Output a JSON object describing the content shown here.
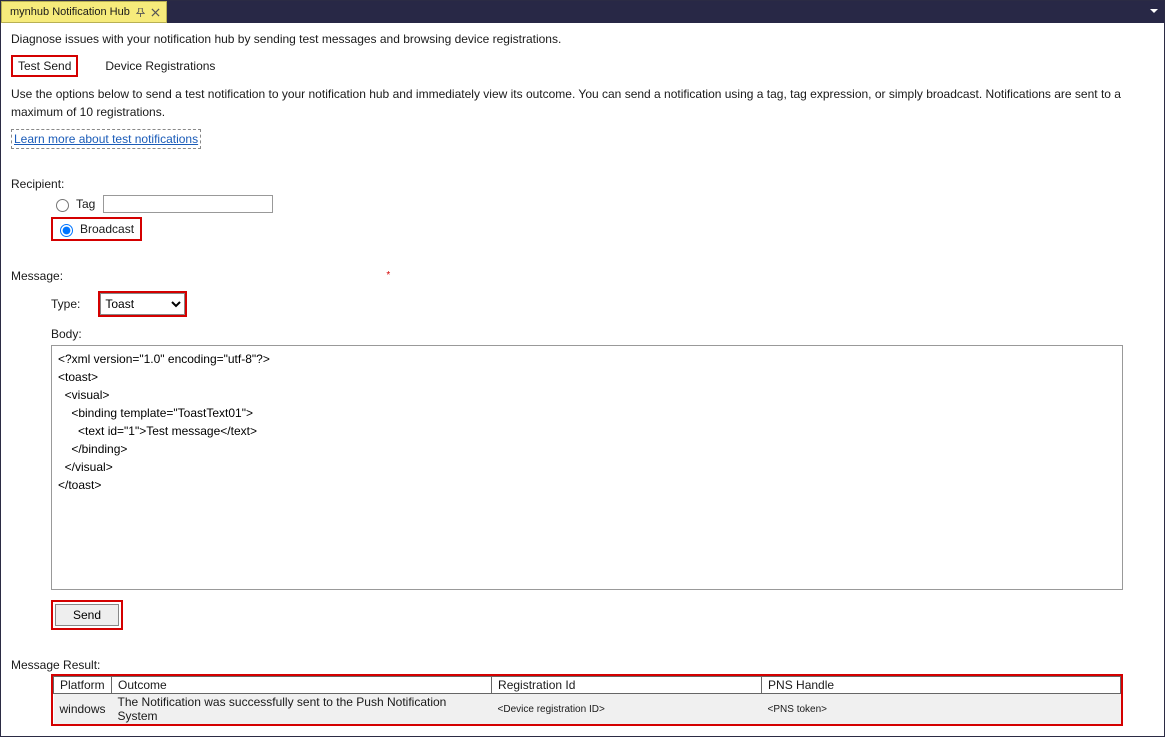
{
  "window": {
    "tab_title": "mynhub Notification Hub"
  },
  "header": {
    "description": "Diagnose issues with your notification hub by sending test messages and browsing device registrations."
  },
  "subtabs": {
    "test_send": "Test Send",
    "device_registrations": "Device Registrations"
  },
  "instructions": {
    "text": "Use the options below to send a test notification to your notification hub and immediately view its outcome. You can send a notification using a tag, tag expression, or simply broadcast. Notifications are sent to a maximum of 10 registrations.",
    "learn_link": "Learn more about test notifications"
  },
  "recipient": {
    "label": "Recipient:",
    "tag_label": "Tag",
    "tag_value": "",
    "broadcast_label": "Broadcast"
  },
  "message": {
    "label": "Message:",
    "type_label": "Type:",
    "type_selected": "Toast",
    "body_label": "Body:",
    "body_value": "<?xml version=\"1.0\" encoding=\"utf-8\"?>\n<toast>\n  <visual>\n    <binding template=\"ToastText01\">\n      <text id=\"1\">Test message</text>\n    </binding>\n  </visual>\n</toast>",
    "send_label": "Send"
  },
  "result": {
    "label": "Message Result:",
    "columns": {
      "platform": "Platform",
      "outcome": "Outcome",
      "registration_id": "Registration Id",
      "pns_handle": "PNS Handle"
    },
    "row": {
      "platform": "windows",
      "outcome": "The Notification was successfully sent to the Push Notification System",
      "registration_id": "<Device registration ID>",
      "pns_handle": "<PNS token>"
    }
  }
}
